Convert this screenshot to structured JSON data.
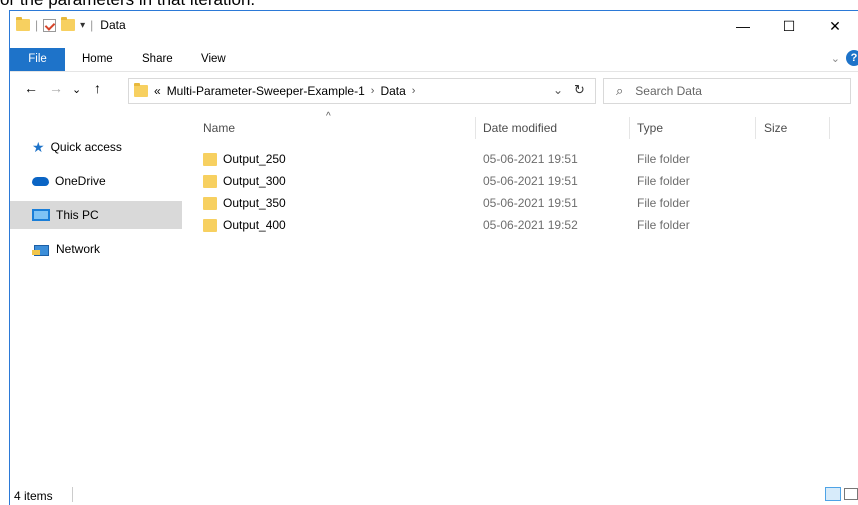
{
  "top_text": "or the parameters in that iteration.",
  "window": {
    "title": "Data",
    "controls": {
      "minimize": "—",
      "maximize": "☐",
      "close": "✕"
    }
  },
  "ribbon": {
    "tabs": [
      "File",
      "Home",
      "Share",
      "View"
    ]
  },
  "nav": {
    "back": "←",
    "forward": "→",
    "recent": "⌄",
    "up": "↑"
  },
  "address": {
    "overflow": "«",
    "crumbs": [
      "Multi-Parameter-Sweeper-Example-1",
      "Data"
    ],
    "separator": "›",
    "refresh": "↻"
  },
  "search": {
    "placeholder": "Search Data"
  },
  "nav_pane": {
    "items": [
      {
        "label": "Quick access",
        "icon": "star-icon"
      },
      {
        "label": "OneDrive",
        "icon": "cloud-icon"
      },
      {
        "label": "This PC",
        "icon": "computer-icon",
        "selected": true
      },
      {
        "label": "Network",
        "icon": "network-icon"
      }
    ]
  },
  "columns": [
    "Name",
    "Date modified",
    "Type",
    "Size"
  ],
  "files": [
    {
      "name": "Output_250",
      "date": "05-06-2021 19:51",
      "type": "File folder"
    },
    {
      "name": "Output_300",
      "date": "05-06-2021 19:51",
      "type": "File folder"
    },
    {
      "name": "Output_350",
      "date": "05-06-2021 19:51",
      "type": "File folder"
    },
    {
      "name": "Output_400",
      "date": "05-06-2021 19:52",
      "type": "File folder"
    }
  ],
  "status": {
    "count": "4 items"
  },
  "colors": {
    "accent": "#1e73c9",
    "folder": "#f7d060",
    "selected_nav": "#d9d9d9"
  }
}
